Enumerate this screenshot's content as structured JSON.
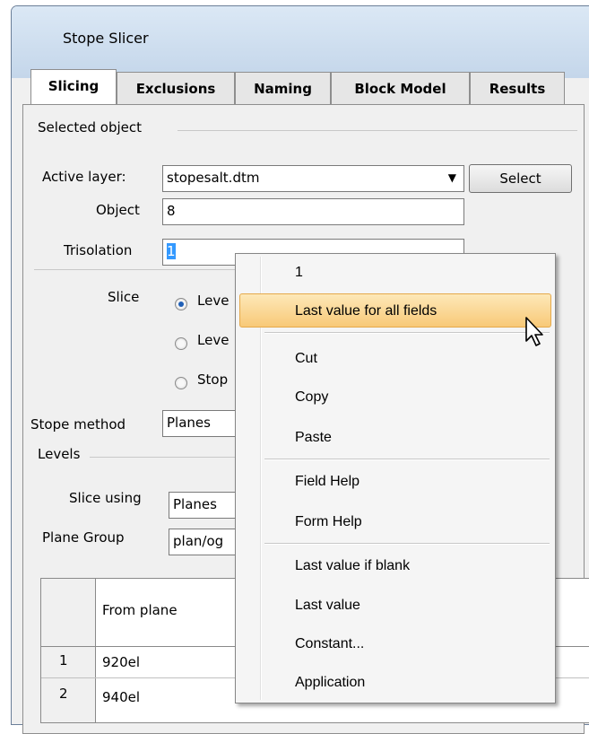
{
  "window": {
    "title": "Stope Slicer"
  },
  "tabs": [
    {
      "label": "Slicing",
      "active": true
    },
    {
      "label": "Exclusions"
    },
    {
      "label": "Naming"
    },
    {
      "label": "Block Model"
    },
    {
      "label": "Results"
    }
  ],
  "selected_object": {
    "group_label": "Selected object",
    "active_layer_label": "Active layer:",
    "active_layer_value": "stopesalt.dtm",
    "select_button": "Select",
    "object_label": "Object",
    "object_value": "8",
    "trisolation_label": "Trisolation",
    "trisolation_value": "1"
  },
  "slice": {
    "label": "Slice",
    "options": [
      "Leve",
      "Leve",
      "Stop"
    ],
    "selected_index": 0
  },
  "stope_method": {
    "label": "Stope method",
    "value": "Planes"
  },
  "levels": {
    "group_label": "Levels",
    "slice_using_label": "Slice using",
    "slice_using_value": "Planes",
    "plane_group_label": "Plane Group",
    "plane_group_value": "plan/og"
  },
  "grid": {
    "columns": [
      "From plane"
    ],
    "rows": [
      {
        "num": "1",
        "from": "920el"
      },
      {
        "num": "2",
        "from": "940el"
      }
    ]
  },
  "context_menu": {
    "items": [
      {
        "label": "1"
      },
      {
        "label": "Last value for all fields",
        "highlighted": true
      },
      {
        "separator": true
      },
      {
        "label": "Cut"
      },
      {
        "label": "Copy"
      },
      {
        "label": "Paste"
      },
      {
        "separator": true
      },
      {
        "label": "Field Help"
      },
      {
        "label": "Form Help"
      },
      {
        "separator": true
      },
      {
        "label": "Last value if blank"
      },
      {
        "label": "Last value"
      },
      {
        "label": "Constant..."
      },
      {
        "label": "Application"
      }
    ]
  }
}
